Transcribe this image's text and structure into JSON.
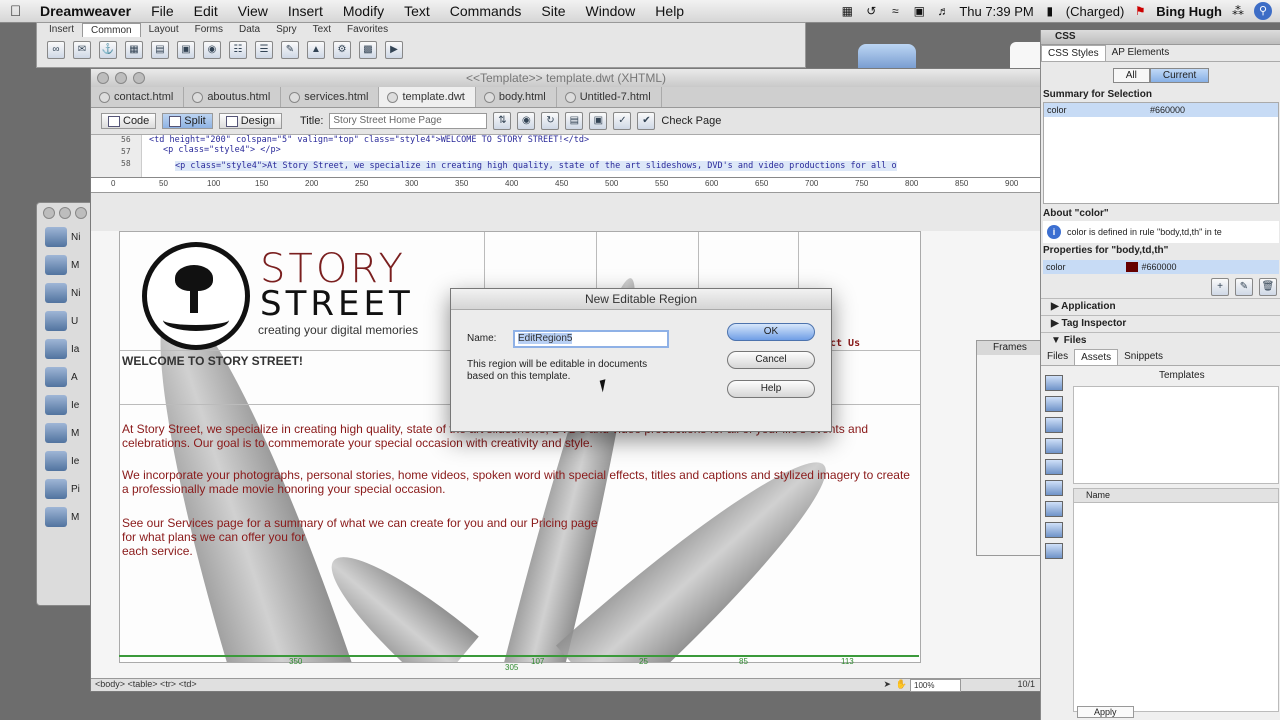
{
  "menubar": {
    "app": "Dreamweaver",
    "items": [
      "File",
      "Edit",
      "View",
      "Insert",
      "Modify",
      "Text",
      "Commands",
      "Site",
      "Window",
      "Help"
    ],
    "clock": "Thu 7:39 PM",
    "battery": "(Charged)",
    "user": "Bing Hugh"
  },
  "insert_panel": {
    "tabs": [
      "Insert",
      "Common",
      "Layout",
      "Forms",
      "Data",
      "Spry",
      "Text",
      "Favorites"
    ]
  },
  "files_window": {
    "items": [
      "Ni",
      "M",
      "Ni",
      "U",
      "Ia",
      "A",
      "Ie",
      "M",
      "Ie",
      "Pi",
      "M"
    ]
  },
  "document": {
    "window_title": "<<Template>> template.dwt (XHTML)",
    "tabs": [
      "contact.html",
      "aboutus.html",
      "services.html",
      "template.dwt",
      "body.html",
      "Untitled-7.html"
    ],
    "view_buttons": [
      "Code",
      "Split",
      "Design"
    ],
    "title_label": "Title:",
    "title_value": "Story Street Home Page",
    "check_page": "Check Page",
    "code_lines": [
      "<td height=\"200\" colspan=\"5\" valign=\"top\" class=\"style4\">WELCOME TO STORY STREET!</td>",
      "<p class=\"style4\"> </p>",
      "<p class=\"style4\">At Story Street, we specialize in creating high quality, state of the art slideshows, DVD's and video productions for all o"
    ],
    "line_numbers": [
      "56",
      "57",
      "58"
    ],
    "ruler_ticks": [
      "0",
      "50",
      "100",
      "150",
      "200",
      "250",
      "300",
      "350",
      "400",
      "450",
      "500",
      "550",
      "600",
      "650",
      "700",
      "750",
      "800",
      "850",
      "900"
    ],
    "status_tags": "<body> <table> <tr> <td>",
    "zoom": "100%",
    "dims": "10/1"
  },
  "page": {
    "brand_line1": "STORY",
    "brand_line2": "STREET",
    "tagline": "creating your digital memories",
    "nav_contact": "ct Us",
    "welcome": "WELCOME TO STORY STREET!",
    "para1": "At Story Street, we specialize in creating high quality, state of the art slideshows, DVD's and video productions for all of your life's events and celebrations. Our goal is to commemorate your special occasion with creativity and style.",
    "para2": "We incorporate your photographs, personal stories, home videos, spoken word with special effects, titles and captions and stylized imagery to create a professionally made movie honoring your special occasion.",
    "para3_l1": "See our Services page for a summary of what we can create for you and our Pricing page",
    "para3_l2": "for what plans we can offer you for",
    "para3_l3": "each service.",
    "table_widths": [
      "350",
      "107",
      "25",
      "85",
      "113"
    ],
    "table_bottom": "305"
  },
  "frames_panel": {
    "title": "Frames"
  },
  "right_panel": {
    "css_header": "CSS",
    "css_tabs": [
      "CSS Styles",
      "AP Elements"
    ],
    "seg_all": "All",
    "seg_current": "Current",
    "summary_label": "Summary for Selection",
    "summary_prop": "color",
    "summary_value": "#660000",
    "about_label": "About \"color\"",
    "about_text": "color is defined in rule \"body,td,th\" in te",
    "props_label": "Properties for \"body,td,th\"",
    "props_prop": "color",
    "props_value": "#660000",
    "application": "Application",
    "tag_inspector": "Tag Inspector",
    "files_header": "Files",
    "files_tabs": [
      "Files",
      "Assets",
      "Snippets"
    ],
    "templates_label": "Templates",
    "name_col": "Name",
    "apply": "Apply"
  },
  "dialog": {
    "title": "New Editable Region",
    "name_label": "Name:",
    "name_value": "EditRegion5",
    "message": "This region will be editable in documents based on this template.",
    "ok": "OK",
    "cancel": "Cancel",
    "help": "Help"
  }
}
